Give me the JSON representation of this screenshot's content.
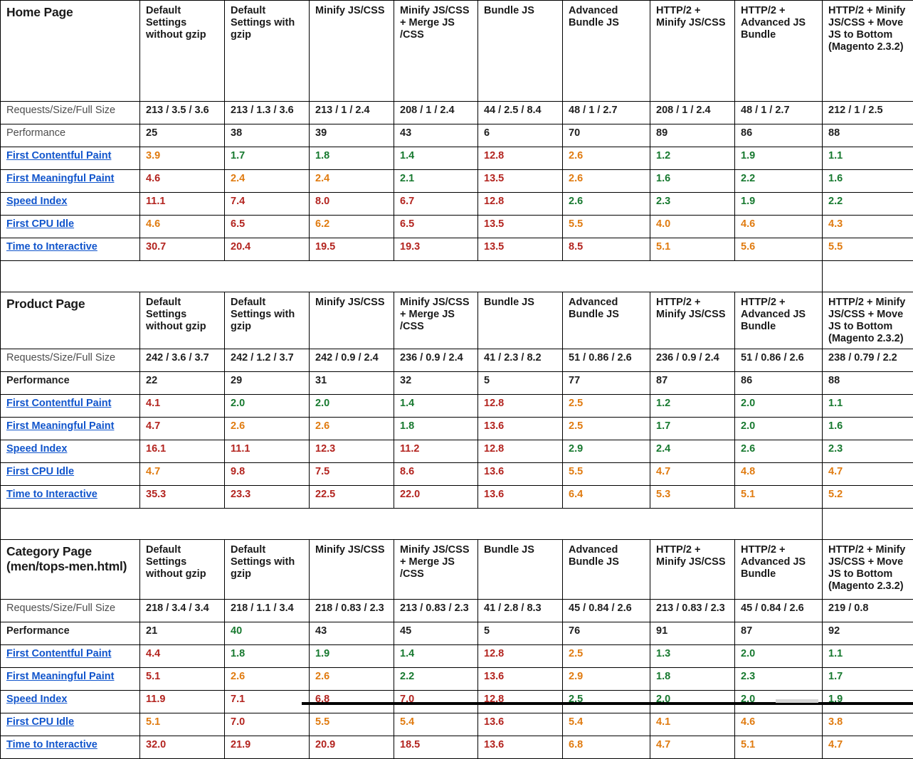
{
  "table": {
    "scenarios": [
      "Default Settings without  gzip",
      "Default Settings with gzip",
      "Minify JS/CSS",
      "Minify JS/CSS + Merge JS /CSS",
      "Bundle JS",
      "Advanced Bundle JS",
      "HTTP/2 + Minify JS/CSS",
      "HTTP/2 + Advanced JS Bundle",
      "HTTP/2 + Minify JS/CSS + Move JS to Bottom (Magento 2.3.2)"
    ],
    "metric_labels": {
      "requests": "Requests/Size/Full Size",
      "performance": "Performance",
      "fcp": "First Contentful Paint",
      "fmp": "First Meaningful Paint",
      "speed_index": "Speed Index",
      "cpu_idle": "First CPU Idle",
      "tti": "Time to Interactive"
    },
    "sections": [
      {
        "title": "Home Page",
        "rows": {
          "requests": [
            "213 / 3.5 / 3.6",
            "213 / 1.3 / 3.6",
            "213 / 1 / 2.4",
            "208 / 1 / 2.4",
            "44 / 2.5 / 8.4",
            "48 / 1 / 2.7",
            "208 / 1 / 2.4",
            "48 / 1 / 2.7",
            "212 / 1 / 2.5"
          ],
          "performance": [
            "25",
            "38",
            "39",
            "43",
            "6",
            "70",
            "89",
            "86",
            "88"
          ],
          "performance_colors": [
            "black",
            "black",
            "black",
            "black",
            "black",
            "black",
            "black",
            "black",
            "black"
          ],
          "fcp": [
            "3.9",
            "1.7",
            "1.8",
            "1.4",
            "12.8",
            "2.6",
            "1.2",
            "1.9",
            "1.1"
          ],
          "fcp_colors": [
            "orange",
            "green",
            "green",
            "green",
            "red",
            "orange",
            "green",
            "green",
            "green"
          ],
          "fmp": [
            "4.6",
            "2.4",
            "2.4",
            "2.1",
            "13.5",
            "2.6",
            "1.6",
            "2.2",
            "1.6"
          ],
          "fmp_colors": [
            "red",
            "orange",
            "orange",
            "green",
            "red",
            "orange",
            "green",
            "green",
            "green"
          ],
          "speed_index": [
            "11.1",
            "7.4",
            "8.0",
            "6.7",
            "12.8",
            "2.6",
            "2.3",
            "1.9",
            "2.2"
          ],
          "speed_index_colors": [
            "red",
            "red",
            "red",
            "red",
            "red",
            "green",
            "green",
            "green",
            "green"
          ],
          "cpu_idle": [
            "4.6",
            "6.5",
            "6.2",
            "6.5",
            "13.5",
            "5.5",
            "4.0",
            "4.6",
            "4.3"
          ],
          "cpu_idle_colors": [
            "orange",
            "red",
            "orange",
            "red",
            "red",
            "orange",
            "orange",
            "orange",
            "orange"
          ],
          "tti": [
            "30.7",
            "20.4",
            "19.5",
            "19.3",
            "13.5",
            "8.5",
            "5.1",
            "5.6",
            "5.5"
          ],
          "tti_colors": [
            "red",
            "red",
            "red",
            "red",
            "red",
            "red",
            "orange",
            "orange",
            "orange"
          ]
        }
      },
      {
        "title": "Product Page",
        "rows": {
          "requests": [
            "242 / 3.6 / 3.7",
            "242 / 1.2 / 3.7",
            "242 / 0.9 / 2.4",
            "236 / 0.9 / 2.4",
            "41 / 2.3 / 8.2",
            "51 / 0.86 / 2.6",
            "236 / 0.9 / 2.4",
            "51 / 0.86 / 2.6",
            "238 / 0.79 / 2.2"
          ],
          "performance": [
            "22",
            "29",
            "31",
            "32",
            "5",
            "77",
            "87",
            "86",
            "88"
          ],
          "performance_colors": [
            "black",
            "black",
            "black",
            "black",
            "black",
            "black",
            "black",
            "black",
            "black"
          ],
          "fcp": [
            "4.1",
            "2.0",
            "2.0",
            "1.4",
            "12.8",
            "2.5",
            "1.2",
            "2.0",
            "1.1"
          ],
          "fcp_colors": [
            "red",
            "green",
            "green",
            "green",
            "red",
            "orange",
            "green",
            "green",
            "green"
          ],
          "fmp": [
            "4.7",
            "2.6",
            "2.6",
            "1.8",
            "13.6",
            "2.5",
            "1.7",
            "2.0",
            "1.6"
          ],
          "fmp_colors": [
            "red",
            "orange",
            "orange",
            "green",
            "red",
            "orange",
            "green",
            "green",
            "green"
          ],
          "speed_index": [
            "16.1",
            "11.1",
            "12.3",
            "11.2",
            "12.8",
            "2.9",
            "2.4",
            "2.6",
            "2.3"
          ],
          "speed_index_colors": [
            "red",
            "red",
            "red",
            "red",
            "red",
            "green",
            "green",
            "green",
            "green"
          ],
          "cpu_idle": [
            "4.7",
            "9.8",
            "7.5",
            "8.6",
            "13.6",
            "5.5",
            "4.7",
            "4.8",
            "4.7"
          ],
          "cpu_idle_colors": [
            "orange",
            "red",
            "red",
            "red",
            "red",
            "orange",
            "orange",
            "orange",
            "orange"
          ],
          "tti": [
            "35.3",
            "23.3",
            "22.5",
            "22.0",
            "13.6",
            "6.4",
            "5.3",
            "5.1",
            "5.2"
          ],
          "tti_colors": [
            "red",
            "red",
            "red",
            "red",
            "red",
            "orange",
            "orange",
            "orange",
            "orange"
          ]
        }
      },
      {
        "title": "Category Page (men/tops-men.html)",
        "rows": {
          "requests": [
            "218 / 3.4 / 3.4",
            "218 / 1.1 / 3.4",
            "218 / 0.83 / 2.3",
            "213 / 0.83 / 2.3",
            "41 / 2.8 / 8.3",
            "45 / 0.84 / 2.6",
            "213 / 0.83 / 2.3",
            "45 / 0.84 / 2.6",
            "219 / 0.8"
          ],
          "performance": [
            "21",
            "40",
            "43",
            "45",
            "5",
            "76",
            "91",
            "87",
            "92"
          ],
          "performance_colors": [
            "black",
            "green",
            "black",
            "black",
            "black",
            "black",
            "black",
            "black",
            "black"
          ],
          "fcp": [
            "4.4",
            "1.8",
            "1.9",
            "1.4",
            "12.8",
            "2.5",
            "1.3",
            "2.0",
            "1.1"
          ],
          "fcp_colors": [
            "red",
            "green",
            "green",
            "green",
            "red",
            "orange",
            "green",
            "green",
            "green"
          ],
          "fmp": [
            "5.1",
            "2.6",
            "2.6",
            "2.2",
            "13.6",
            "2.9",
            "1.8",
            "2.3",
            "1.7"
          ],
          "fmp_colors": [
            "red",
            "orange",
            "orange",
            "green",
            "red",
            "orange",
            "green",
            "green",
            "green"
          ],
          "speed_index": [
            "11.9",
            "7.1",
            "6.8",
            "7.0",
            "12.8",
            "2.5",
            "2.0",
            "2.0",
            "1.9"
          ],
          "speed_index_colors": [
            "red",
            "red",
            "red",
            "red",
            "red",
            "green",
            "green",
            "green",
            "green"
          ],
          "cpu_idle": [
            "5.1",
            "7.0",
            "5.5",
            "5.4",
            "13.6",
            "5.4",
            "4.1",
            "4.6",
            "3.8"
          ],
          "cpu_idle_colors": [
            "orange",
            "red",
            "orange",
            "orange",
            "red",
            "orange",
            "orange",
            "orange",
            "orange"
          ],
          "tti": [
            "32.0",
            "21.9",
            "20.9",
            "18.5",
            "13.6",
            "6.8",
            "4.7",
            "5.1",
            "4.7"
          ],
          "tti_colors": [
            "red",
            "red",
            "red",
            "red",
            "red",
            "orange",
            "orange",
            "orange",
            "orange"
          ]
        }
      }
    ]
  },
  "colors": {
    "good": "#17792f",
    "average": "#e07b10",
    "poor": "#b3241f",
    "link": "#1155cc",
    "text": "#1f1f1f",
    "muted": "#4d4d4d",
    "border": "#000000"
  }
}
